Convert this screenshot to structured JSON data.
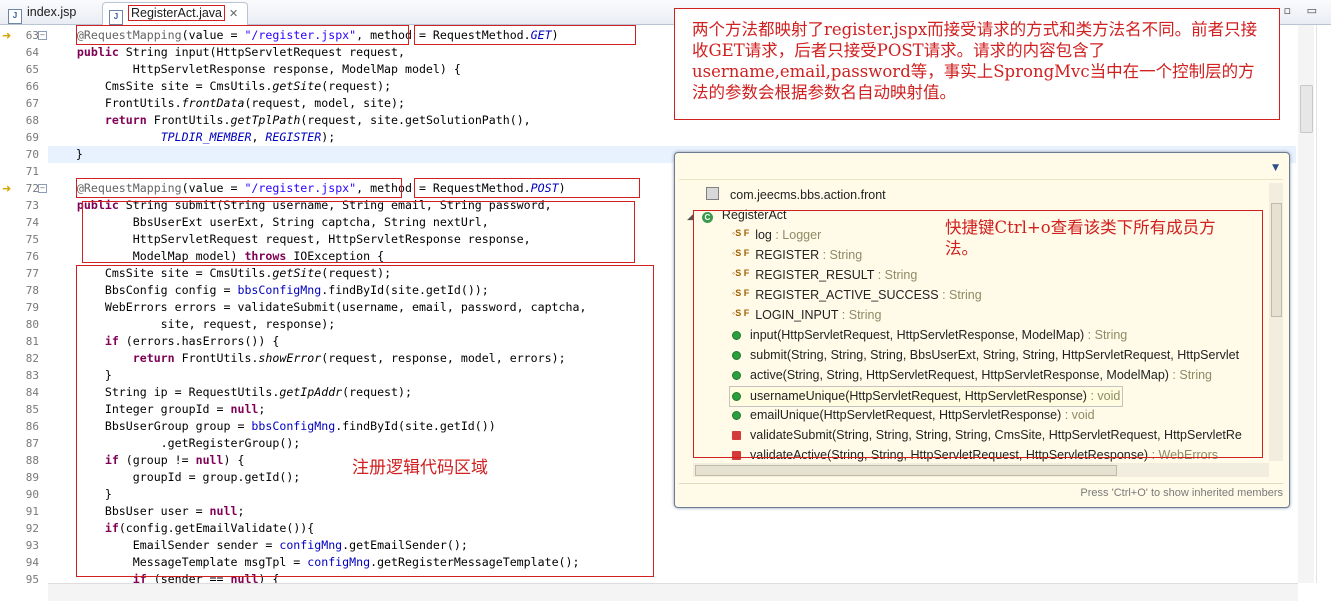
{
  "tabs": [
    {
      "label": "index.jsp",
      "icon": "jsp-file-icon"
    },
    {
      "label": "RegisterAct.java",
      "icon": "java-file-icon",
      "active": true
    }
  ],
  "window_controls": "▫ ▭",
  "code_lines": [
    {
      "n": "63",
      "html": "    <span class=\"an\">@RequestMapping</span>(value = <span class=\"st\">\"/register.jspx\"</span>, method = RequestMethod.<span class=\"fd\">GET</span>)"
    },
    {
      "n": "64",
      "html": "    <span class=\"kw\">public</span> String input(HttpServletRequest request,"
    },
    {
      "n": "65",
      "html": "            HttpServletResponse response, ModelMap model) {"
    },
    {
      "n": "66",
      "html": "        CmsSite site = CmsUtils.<span class=\"it\">getSite</span>(request);"
    },
    {
      "n": "67",
      "html": "        FrontUtils.<span class=\"it\">frontData</span>(request, model, site);"
    },
    {
      "n": "68",
      "html": "        <span class=\"kw\">return</span> FrontUtils.<span class=\"it\">getTplPath</span>(request, site.getSolutionPath(),"
    },
    {
      "n": "69",
      "html": "                <span class=\"fd\">TPLDIR_MEMBER</span>, <span class=\"fd\">REGISTER</span>);"
    },
    {
      "n": "70",
      "html": "    }"
    },
    {
      "n": "71",
      "html": ""
    },
    {
      "n": "72",
      "html": "    <span class=\"an\">@RequestMapping</span>(value = <span class=\"st\">\"/register.jspx\"</span>, method = RequestMethod.<span class=\"fd\">POST</span>)"
    },
    {
      "n": "73",
      "html": "    <span class=\"kw\">public</span> String submit(String username, String email, String password,"
    },
    {
      "n": "74",
      "html": "            BbsUserExt userExt, String captcha, String nextUrl,"
    },
    {
      "n": "75",
      "html": "            HttpServletRequest request, HttpServletResponse response,"
    },
    {
      "n": "76",
      "html": "            ModelMap model) <span class=\"kw\">throws</span> IOException {"
    },
    {
      "n": "77",
      "html": "        CmsSite site = CmsUtils.<span class=\"it\">getSite</span>(request);"
    },
    {
      "n": "78",
      "html": "        BbsConfig config = <span class=\"fv\">bbsConfigMng</span>.findById(site.getId());"
    },
    {
      "n": "79",
      "html": "        WebErrors errors = validateSubmit(username, email, password, captcha,"
    },
    {
      "n": "80",
      "html": "                site, request, response);"
    },
    {
      "n": "81",
      "html": "        <span class=\"kw\">if</span> (errors.hasErrors()) {"
    },
    {
      "n": "82",
      "html": "            <span class=\"kw\">return</span> FrontUtils.<span class=\"it\">showError</span>(request, response, model, errors);"
    },
    {
      "n": "83",
      "html": "        }"
    },
    {
      "n": "84",
      "html": "        String ip = RequestUtils.<span class=\"it\">getIpAddr</span>(request);"
    },
    {
      "n": "85",
      "html": "        Integer groupId = <span class=\"kw\">null</span>;"
    },
    {
      "n": "86",
      "html": "        BbsUserGroup group = <span class=\"fv\">bbsConfigMng</span>.findById(site.getId())"
    },
    {
      "n": "87",
      "html": "                .getRegisterGroup();"
    },
    {
      "n": "88",
      "html": "        <span class=\"kw\">if</span> (group != <span class=\"kw\">null</span>) {"
    },
    {
      "n": "89",
      "html": "            groupId = group.getId();"
    },
    {
      "n": "90",
      "html": "        }"
    },
    {
      "n": "91",
      "html": "        BbsUser user = <span class=\"kw\">null</span>;"
    },
    {
      "n": "92",
      "html": "        <span class=\"kw\">if</span>(config.getEmailValidate()){"
    },
    {
      "n": "93",
      "html": "            EmailSender sender = <span class=\"fv\">configMng</span>.getEmailSender();"
    },
    {
      "n": "94",
      "html": "            MessageTemplate msgTpl = <span class=\"fv\">configMng</span>.getRegisterMessageTemplate();"
    },
    {
      "n": "95",
      "html": "            <span class=\"kw\">if</span> (sender == <span class=\"kw\">null</span>) {"
    }
  ],
  "notes": {
    "top_right": "两个方法都映射了register.jspx而接受请求的方式和类方法名不同。前者只接收GET请求，后者只接受POST请求。请求的内容包含了username,email,password等，事实上SprongMvc当中在一个控制层的方法的参数会根据参数名自动映射值。",
    "code_region": "注册逻辑代码区域",
    "popup": "快捷键Ctrl+o查看该类下所有成员方法。"
  },
  "outline": {
    "package": "com.jeecms.bbs.action.front",
    "class": "RegisterAct",
    "members": [
      {
        "kind": "sf",
        "name": "log",
        "type": " : Logger"
      },
      {
        "kind": "sf",
        "name": "REGISTER",
        "type": " : String"
      },
      {
        "kind": "sf",
        "name": "REGISTER_RESULT",
        "type": " : String"
      },
      {
        "kind": "sf",
        "name": "REGISTER_ACTIVE_SUCCESS",
        "type": " : String"
      },
      {
        "kind": "sf",
        "name": "LOGIN_INPUT",
        "type": " : String"
      },
      {
        "kind": "pub",
        "name": "input(HttpServletRequest, HttpServletResponse, ModelMap)",
        "type": " : String"
      },
      {
        "kind": "pub",
        "name": "submit(String, String, String, BbsUserExt, String, String, HttpServletRequest, HttpServlet",
        "type": ""
      },
      {
        "kind": "pub",
        "name": "active(String, String, HttpServletRequest, HttpServletResponse, ModelMap)",
        "type": " : String"
      },
      {
        "kind": "pub",
        "name": "usernameUnique(HttpServletRequest, HttpServletResponse)",
        "type": " : void",
        "selected": true
      },
      {
        "kind": "pub",
        "name": "emailUnique(HttpServletRequest, HttpServletResponse)",
        "type": " : void"
      },
      {
        "kind": "priv",
        "name": "validateSubmit(String, String, String, String, CmsSite, HttpServletRequest, HttpServletRe",
        "type": ""
      },
      {
        "kind": "priv",
        "name": "validateActive(String, String, HttpServletRequest, HttpServletResponse)",
        "type": " : WebErrors"
      }
    ],
    "footer": "Press 'Ctrl+O' to show inherited members"
  },
  "colors": {
    "annotation_red": "#d02020",
    "keyword": "#7f0055",
    "string": "#2a00ff",
    "field": "#0000c0"
  }
}
